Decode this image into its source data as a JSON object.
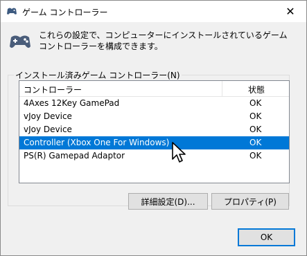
{
  "window": {
    "title": "ゲーム コントローラー",
    "close_symbol": "✕"
  },
  "description": "これらの設定で、コンピューターにインストールされているゲーム コントローラーを構成できます。",
  "group": {
    "label": "インストール済みゲーム コントローラー(N)",
    "columns": {
      "controller": "コントローラー",
      "status": "状態"
    },
    "rows": [
      {
        "name": "4Axes 12Key GamePad",
        "status": "OK"
      },
      {
        "name": "vJoy Device",
        "status": "OK"
      },
      {
        "name": "vJoy Device",
        "status": "OK"
      },
      {
        "name": "Controller (Xbox One For Windows)",
        "status": "OK"
      },
      {
        "name": "PS(R) Gamepad Adaptor",
        "status": "OK"
      }
    ],
    "selected_index": 3
  },
  "buttons": {
    "advanced": "詳細設定(D)...",
    "properties": "プロパティ(P)",
    "ok": "OK"
  },
  "colors": {
    "selection": "#0078d7",
    "background": "#f0f0f0"
  },
  "icons": {
    "title": "gamepad-icon",
    "main": "gamepad-icon",
    "pointer": "mouse-cursor-icon"
  }
}
